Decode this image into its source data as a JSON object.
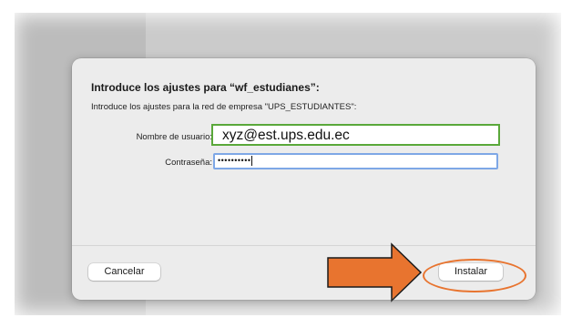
{
  "dialog": {
    "title": "Introduce los ajustes para “wf_estudianes”:",
    "subtitle": "Introduce los ajustes para la red de empresa \"UPS_ESTUDIANTES\":",
    "username_label": "Nombre de usuario:",
    "username_value": "xyz@est.ups.edu.ec",
    "password_label": "Contraseña:",
    "password_value": "••••••••••",
    "cancel_label": "Cancelar",
    "install_label": "Instalar"
  },
  "annotations": {
    "arrow_color": "#e8742f",
    "highlight_color": "#e8742f",
    "username_highlight_color": "#5aa83a",
    "focus_ring_color": "#7ea7e6"
  }
}
